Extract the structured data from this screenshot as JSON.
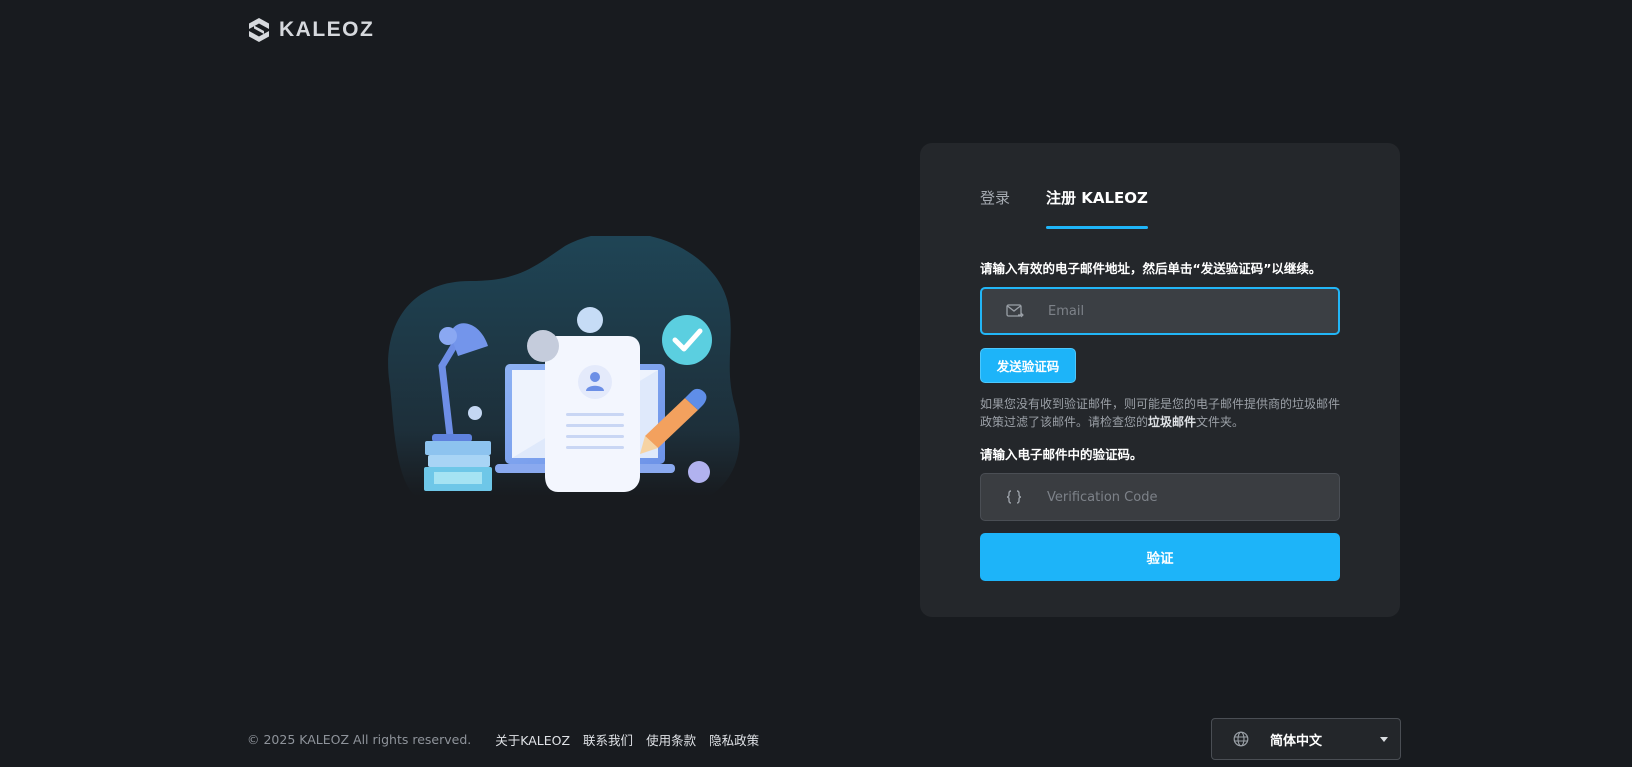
{
  "brand": {
    "name": "KALEOZ"
  },
  "tabs": [
    {
      "label": "登录",
      "active": false
    },
    {
      "label": "注册 KALEOZ",
      "active": true
    }
  ],
  "register": {
    "email_instruction": "请输入有效的电子邮件地址，然后单击“发送验证码”以继续。",
    "email_placeholder": "Email",
    "send_code_label": "发送验证码",
    "hint_part1": "如果您没有收到验证邮件，则可能是您的电子邮件提供商的垃圾邮件政策过滤了该邮件。请检查您的",
    "hint_bold": "垃圾邮件",
    "hint_part2": "文件夹。",
    "code_instruction": "请输入电子邮件中的验证码。",
    "code_placeholder": "Verification Code",
    "verify_label": "验证"
  },
  "footer": {
    "copyright": "© 2025 KALEOZ All rights reserved.",
    "links": [
      "关于KALEOZ",
      "联系我们",
      "使用条款",
      "隐私政策"
    ],
    "language": "简体中文"
  },
  "colors": {
    "accent": "#1db4f9",
    "background": "#181b1f",
    "card": "#24272b"
  },
  "icons": {
    "email": "mail-icon",
    "code": "braces-icon",
    "language": "globe-icon",
    "dropdown": "caret-down-icon"
  }
}
